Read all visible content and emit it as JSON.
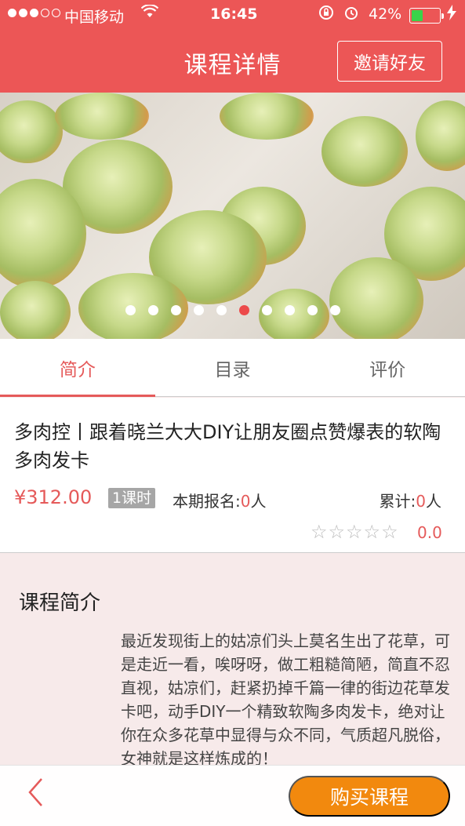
{
  "status_bar": {
    "carrier": "中国移动",
    "time": "16:45",
    "battery_percent": "42%",
    "battery_level": 0.42,
    "icons": [
      "signal-dots-icon",
      "wifi-icon",
      "rotation-lock-icon",
      "alarm-icon",
      "battery-icon",
      "charging-bolt-icon"
    ]
  },
  "nav": {
    "title": "课程详情",
    "invite_label": "邀请好友"
  },
  "carousel": {
    "total_pages": 10,
    "active_index": 5,
    "active_color": "#ec4a4a"
  },
  "tabs": [
    {
      "label": "简介",
      "active": true
    },
    {
      "label": "目录",
      "active": false
    },
    {
      "label": "评价",
      "active": false
    }
  ],
  "course": {
    "title": "多肉控丨跟着晓兰大大DIY让朋友圈点赞爆表的软陶多肉发卡",
    "price": "¥312.00",
    "lessons": "1课时",
    "enroll_label": "本期报名:",
    "enroll_count": "0",
    "enroll_unit": "人",
    "total_label": "累计:",
    "total_count": "0",
    "total_unit": "人",
    "stars": "☆☆☆☆☆",
    "rating": "0.0"
  },
  "intro": {
    "heading": "课程简介",
    "text": "最近发现街上的姑凉们头上莫名生出了花草，可是走近一看，唉呀呀，做工粗糙简陋，简直不忍直视，姑凉们，赶紧扔掉千篇一律的街边花草发卡吧，动手DIY一个精致软陶多肉发卡，绝对让你在众多花草中显得与众不同，气质超凡脱俗，女神就是这样炼成的！"
  },
  "bottom": {
    "back_icon": "‹",
    "buy_label": "购买课程"
  },
  "colors": {
    "brand_red": "#ec5656",
    "accent_red": "#e55a5a",
    "buy_orange": "#f2890e"
  }
}
